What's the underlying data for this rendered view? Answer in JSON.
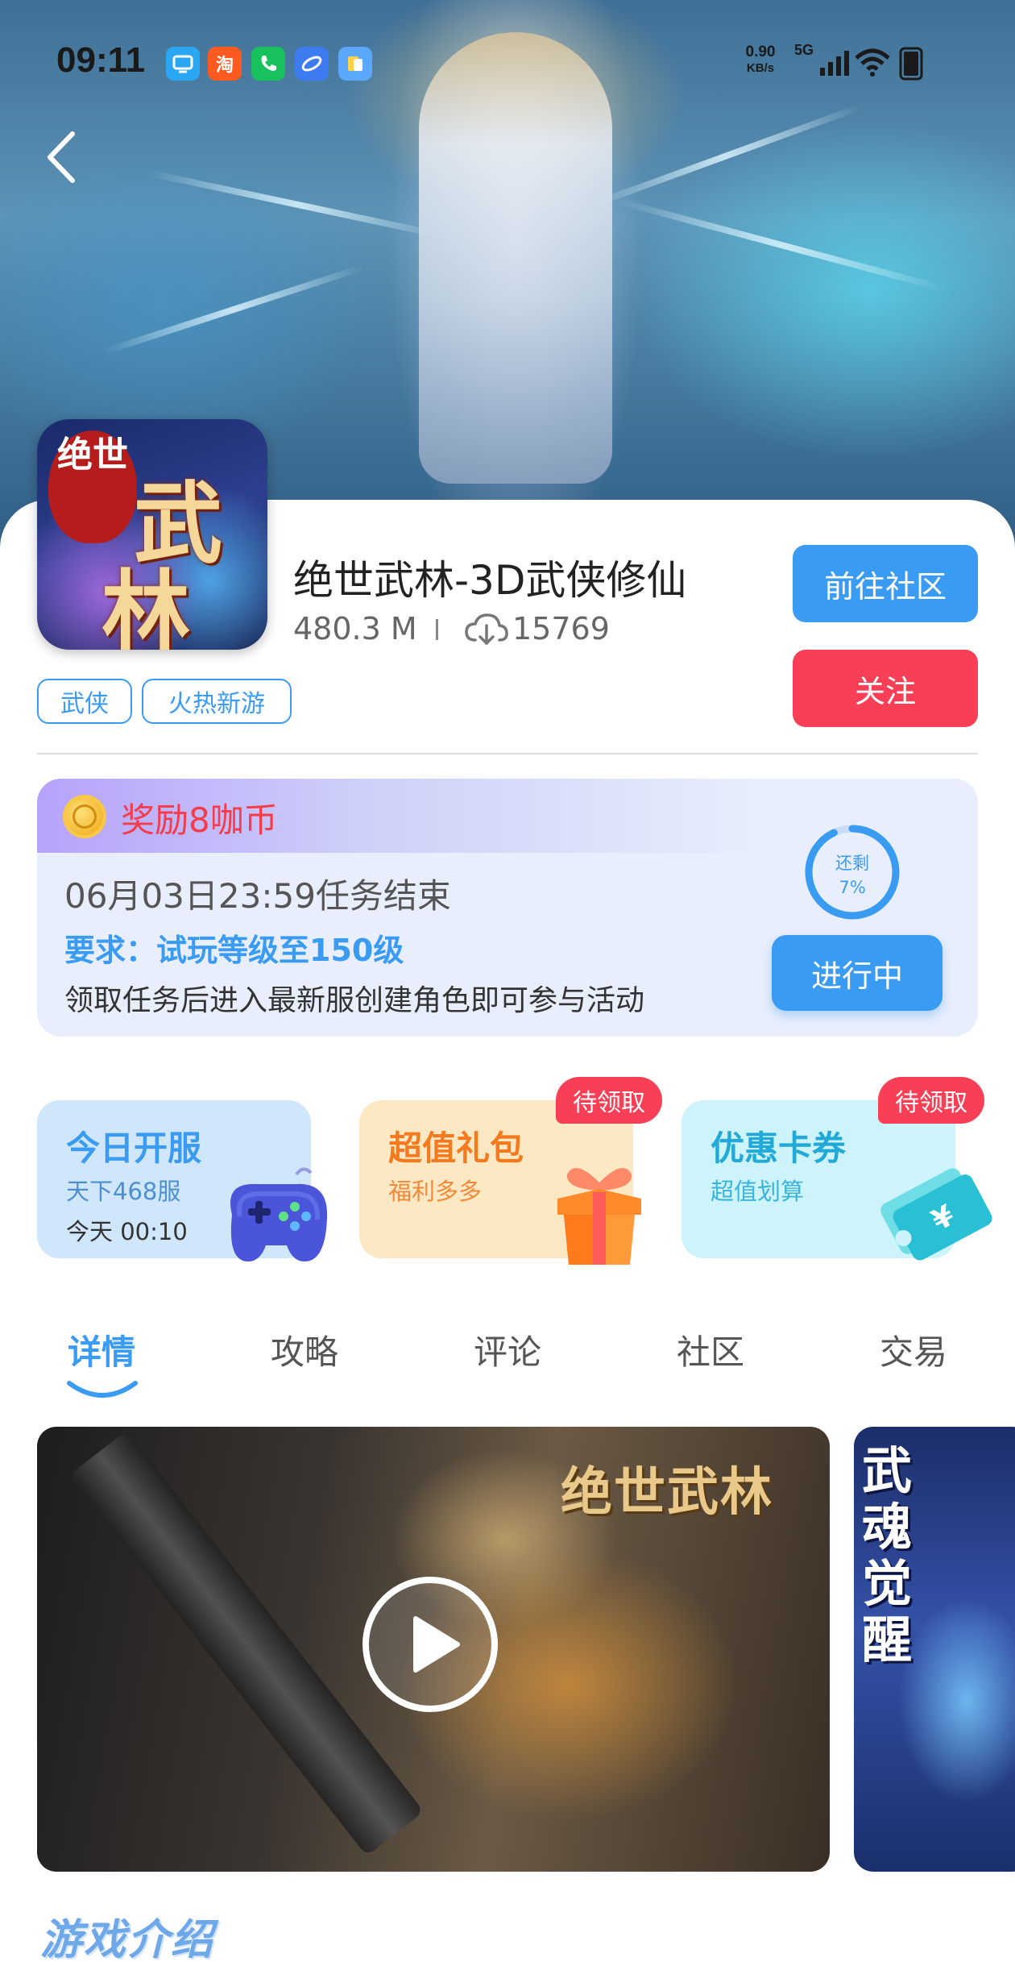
{
  "status_bar": {
    "time": "09:11",
    "net_speed_value": "0.90",
    "net_speed_unit": "KB/s",
    "network": "5G",
    "apps": [
      "tv-app-icon",
      "taobao-icon",
      "phone-app-icon",
      "browser-icon",
      "files-icon"
    ],
    "taobao_label": "淘"
  },
  "hero": {
    "back_icon": "chevron-left-icon"
  },
  "game": {
    "icon_seal_text": "绝世",
    "icon_text_1": "武",
    "icon_text_2": "林",
    "title": "绝世武林-3D武侠修仙",
    "size": "480.3 M",
    "downloads": "15769",
    "tags": [
      "武侠",
      "火热新游"
    ],
    "community_button": "前往社区",
    "follow_button": "关注"
  },
  "reward": {
    "title": "奖励8咖币",
    "deadline": "06月03日23:59任务结束",
    "requirement": "要求：试玩等级至150级",
    "description": "领取任务后进入最新服创建角色即可参与活动",
    "remaining_label": "还剩",
    "remaining_percent_text": "7%",
    "remaining_fraction": 0.07,
    "status_button": "进行中"
  },
  "features": [
    {
      "title": "今日开服",
      "subtitle": "天下468服",
      "subtitle2": "今天 00:10"
    },
    {
      "title": "超值礼包",
      "subtitle": "福利多多",
      "badge": "待领取"
    },
    {
      "title": "优惠卡券",
      "subtitle": "超值划算",
      "badge": "待领取"
    }
  ],
  "tabs": [
    "详情",
    "攻略",
    "评论",
    "社区",
    "交易"
  ],
  "active_tab": "详情",
  "media": {
    "main_art_title": "绝世武林",
    "side_art_title": "武魂觉醒"
  },
  "section_title": "游戏介绍",
  "colors": {
    "accent": "#3a9bf2",
    "follow": "#f93f56",
    "reward_title": "#f53c4b"
  }
}
